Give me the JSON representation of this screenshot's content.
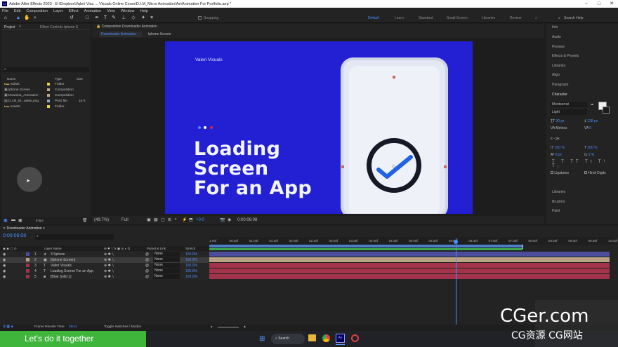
{
  "window": {
    "title": "Adobe After Effects 2023 - E:\\Dropbox\\Valeri Visu ... Visuals Online Cours\\D.I.M_Micro Animation\\Ae\\Animation For Portfolio.aep *"
  },
  "menu": [
    "File",
    "Edit",
    "Composition",
    "Layer",
    "Effect",
    "Animation",
    "View",
    "Window",
    "Help"
  ],
  "toolbar": {
    "snapping": "Snapping",
    "workspaces": [
      "Default",
      "Learn",
      "Standard",
      "Small Screen",
      "Libraries",
      "Review"
    ],
    "search_placeholder": "Search Help"
  },
  "project": {
    "tab": "Project",
    "effect_tab": "Effect Controls Iphone S",
    "cols": [
      "Name",
      "Type",
      "Size"
    ],
    "items": [
      {
        "name": "Solids",
        "type": "Folder",
        "size": ""
      },
      {
        "name": "Iphone Screen",
        "type": "Composition",
        "size": ""
      },
      {
        "name": "Downloa_Animation",
        "type": "Composition",
        "size": ""
      },
      {
        "name": "D.I.M_M...alette.png",
        "type": "PNG file",
        "size": "16 K"
      },
      {
        "name": "Assets",
        "type": "Folder",
        "size": ""
      }
    ],
    "footer": "8 bpc"
  },
  "comp": {
    "header": "Composition Downloader Animation",
    "tabs": [
      "Downloader Animation",
      "Iphone Screen"
    ],
    "zoom": "(49.7%)",
    "resolution": "Full",
    "timecode": "0:00:06:08",
    "plus": "+0.0"
  },
  "canvas": {
    "brand": "Valeri Visuals",
    "headline": [
      "Loading",
      "Screen",
      "For an App"
    ],
    "bg": "#2320d4",
    "dot_colors": [
      "#4a86ff",
      "#ffffff",
      "#e0263a"
    ]
  },
  "right_panel": {
    "items": [
      "Info",
      "Audio",
      "Preview",
      "Effects & Presets",
      "Libraries",
      "Align",
      "Paragraph"
    ],
    "character": "Character",
    "font": "Montserrat",
    "style": "Light",
    "size": "30 px",
    "leading": "128 px",
    "kerning": "Metrics",
    "tracking": "0",
    "stroke": "- px",
    "vscale": "100 %",
    "hscale": "100 %",
    "baseline": "0 px",
    "tsume": "0 %",
    "ligatures": "Ligatures",
    "hindi": "Hindi Digits",
    "bottom": [
      "Libraries",
      "Brushes",
      "Paint"
    ]
  },
  "timeline": {
    "tab": "Downloader Animation",
    "timecode": "0:00:06:08",
    "col_name": "Layer Name",
    "col_parent": "Parent & Link",
    "col_stretch": "Stretch",
    "ticks": [
      "1:00f",
      "00:30f",
      "01:00f",
      "01:30f",
      "02:00f",
      "02:30f",
      "03:00f",
      "03:30f",
      "04:00f",
      "04:30f",
      "05:00f",
      "05:30f",
      "06:00f",
      "06:30f",
      "07:00f",
      "07:30f",
      "08:00f",
      "08:30f",
      "09:00f",
      "09:30f",
      "10:00f"
    ],
    "layers": [
      {
        "num": "1",
        "name": "3 Sphere",
        "type": "★",
        "parent": "None",
        "stretch": "100.0%",
        "color": "#4d4d9e"
      },
      {
        "num": "2",
        "name": "[Iphone Screen]",
        "type": "▣",
        "parent": "None",
        "stretch": "100.0%",
        "color": "#b7a383"
      },
      {
        "num": "3",
        "name": "Valeri Visuals",
        "type": "T",
        "parent": "None",
        "stretch": "100.0%",
        "color": "#a3334a"
      },
      {
        "num": "4",
        "name": "Loading Screen For an App",
        "type": "T",
        "parent": "None",
        "stretch": "100.0%",
        "color": "#a3334a"
      },
      {
        "num": "5",
        "name": "[Blue Solid 1]",
        "type": "■",
        "parent": "None",
        "stretch": "100.0%",
        "color": "#a3334a"
      }
    ],
    "footer_render": "Frame Render Time",
    "render_ms": "26ms",
    "toggle": "Toggle Switches / Modes"
  },
  "taskbar": {
    "banner": "Let's do it together",
    "search": "Search"
  },
  "watermark": {
    "main": "CGer.com",
    "sub": "CG资源 CG网站"
  }
}
